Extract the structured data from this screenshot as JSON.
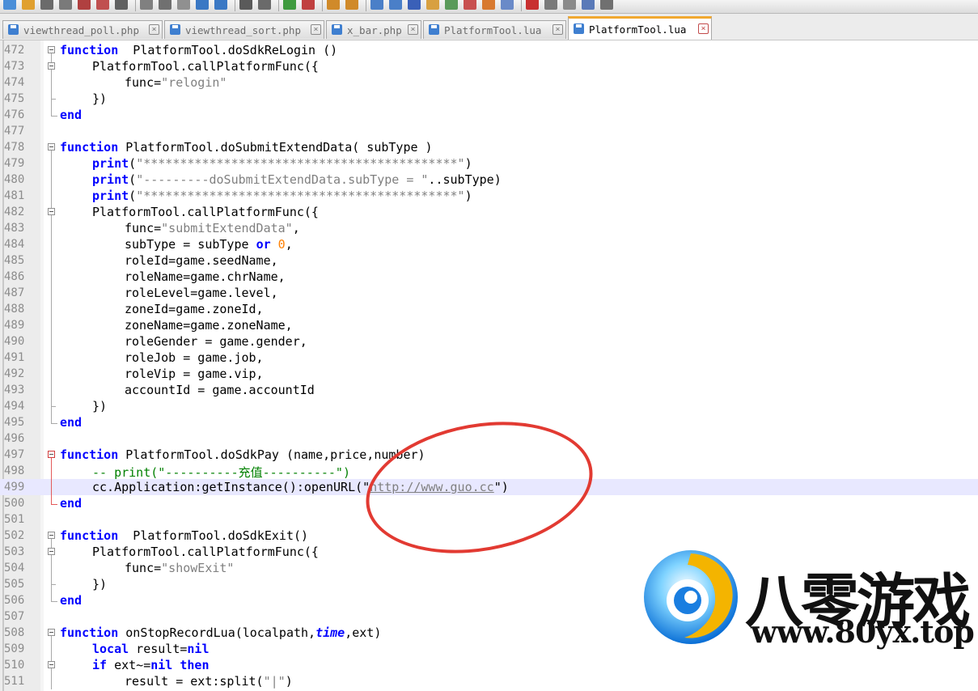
{
  "toolbar": {
    "icons": [
      "new-file-icon",
      "open-file-icon",
      "save-icon",
      "save-all-icon",
      "close-icon",
      "close-all-icon",
      "print-icon",
      "cut-icon",
      "copy-icon",
      "paste-icon",
      "undo-icon",
      "redo-icon",
      "find-icon",
      "replace-icon",
      "zoom-in-icon",
      "zoom-out-icon",
      "sync-vertical-icon",
      "sync-horizontal-icon",
      "word-wrap-icon",
      "show-all-chars-icon",
      "indent-guide-icon",
      "user-language-icon",
      "doc-map-icon",
      "function-list-icon",
      "folder-workspace-icon",
      "monitoring-icon",
      "record-macro-icon",
      "stop-record-icon",
      "play-macro-icon",
      "run-macro-multiple-icon",
      "save-macro-icon"
    ]
  },
  "tabs": [
    {
      "label": "viewthread_poll.php",
      "active": false
    },
    {
      "label": "viewthread_sort.php",
      "active": false
    },
    {
      "label": "x_bar.php",
      "active": false
    },
    {
      "label": "PlatformTool.lua",
      "active": false
    },
    {
      "label": "PlatformTool.lua",
      "active": true
    }
  ],
  "editor": {
    "current_line": "499",
    "lines": [
      {
        "n": "472",
        "segments": [
          [
            "kw",
            "function"
          ],
          [
            "",
            "  PlatformTool.doSdkReLogin ()"
          ]
        ]
      },
      {
        "n": "473",
        "segments": [
          [
            "",
            "PlatformTool.callPlatformFunc({"
          ]
        ]
      },
      {
        "n": "474",
        "segments": [
          [
            "",
            "func="
          ],
          [
            "str",
            "\"relogin\""
          ]
        ]
      },
      {
        "n": "475",
        "segments": [
          [
            "",
            "})"
          ]
        ]
      },
      {
        "n": "476",
        "segments": [
          [
            "kw",
            "end"
          ]
        ]
      },
      {
        "n": "477",
        "segments": []
      },
      {
        "n": "478",
        "segments": [
          [
            "kw",
            "function"
          ],
          [
            "",
            " PlatformTool.doSubmitExtendData( subType )"
          ]
        ]
      },
      {
        "n": "479",
        "segments": [
          [
            "kw",
            "print"
          ],
          [
            "",
            "("
          ],
          [
            "str",
            "\"*******************************************\""
          ],
          [
            "",
            ")"
          ]
        ]
      },
      {
        "n": "480",
        "segments": [
          [
            "kw",
            "print"
          ],
          [
            "",
            "("
          ],
          [
            "str",
            "\"---------doSubmitExtendData.subType = \""
          ],
          [
            "",
            "..subType)"
          ]
        ]
      },
      {
        "n": "481",
        "segments": [
          [
            "kw",
            "print"
          ],
          [
            "",
            "("
          ],
          [
            "str",
            "\"*******************************************\""
          ],
          [
            "",
            ")"
          ]
        ]
      },
      {
        "n": "482",
        "segments": [
          [
            "",
            "PlatformTool.callPlatformFunc({"
          ]
        ]
      },
      {
        "n": "483",
        "segments": [
          [
            "",
            "func="
          ],
          [
            "str",
            "\"submitExtendData\""
          ],
          [
            "",
            ","
          ]
        ]
      },
      {
        "n": "484",
        "segments": [
          [
            "",
            "subType = subType "
          ],
          [
            "kw",
            "or"
          ],
          [
            "",
            " "
          ],
          [
            "num",
            "0"
          ],
          [
            "",
            ","
          ]
        ]
      },
      {
        "n": "485",
        "segments": [
          [
            "",
            "roleId=game.seedName,"
          ]
        ]
      },
      {
        "n": "486",
        "segments": [
          [
            "",
            "roleName=game.chrName,"
          ]
        ]
      },
      {
        "n": "487",
        "segments": [
          [
            "",
            "roleLevel=game.level,"
          ]
        ]
      },
      {
        "n": "488",
        "segments": [
          [
            "",
            "zoneId=game.zoneId,"
          ]
        ]
      },
      {
        "n": "489",
        "segments": [
          [
            "",
            "zoneName=game.zoneName,"
          ]
        ]
      },
      {
        "n": "490",
        "segments": [
          [
            "",
            "roleGender = game.gender,"
          ]
        ]
      },
      {
        "n": "491",
        "segments": [
          [
            "",
            "roleJob = game.job,"
          ]
        ]
      },
      {
        "n": "492",
        "segments": [
          [
            "",
            "roleVip = game.vip,"
          ]
        ]
      },
      {
        "n": "493",
        "segments": [
          [
            "",
            "accountId = game.accountId"
          ]
        ]
      },
      {
        "n": "494",
        "segments": [
          [
            "",
            "})"
          ]
        ]
      },
      {
        "n": "495",
        "segments": [
          [
            "kw",
            "end"
          ]
        ]
      },
      {
        "n": "496",
        "segments": []
      },
      {
        "n": "497",
        "segments": [
          [
            "kw",
            "function"
          ],
          [
            "",
            " PlatformTool.doSdkPay (name,price,number)"
          ]
        ]
      },
      {
        "n": "498",
        "segments": [
          [
            "cm",
            "-- print(\"----------充值----------\")"
          ]
        ]
      },
      {
        "n": "499",
        "segments": [
          [
            "",
            "cc.Application:getInstance():openURL(\""
          ],
          [
            "url",
            "http://www.guo.cc"
          ],
          [
            "",
            "\")"
          ]
        ]
      },
      {
        "n": "500",
        "segments": [
          [
            "kw",
            "end"
          ]
        ]
      },
      {
        "n": "501",
        "segments": []
      },
      {
        "n": "502",
        "segments": [
          [
            "kw",
            "function"
          ],
          [
            "",
            "  PlatformTool.doSdkExit()"
          ]
        ]
      },
      {
        "n": "503",
        "segments": [
          [
            "",
            "PlatformTool.callPlatformFunc({"
          ]
        ]
      },
      {
        "n": "504",
        "segments": [
          [
            "",
            "func="
          ],
          [
            "str",
            "\"showExit\""
          ]
        ]
      },
      {
        "n": "505",
        "segments": [
          [
            "",
            "})"
          ]
        ]
      },
      {
        "n": "506",
        "segments": [
          [
            "kw",
            "end"
          ]
        ]
      },
      {
        "n": "507",
        "segments": []
      },
      {
        "n": "508",
        "segments": [
          [
            "kw",
            "function"
          ],
          [
            "",
            " onStopRecordLua(localpath,"
          ],
          [
            "em",
            "time"
          ],
          [
            "",
            ",ext)"
          ]
        ]
      },
      {
        "n": "509",
        "segments": [
          [
            "kw",
            "local"
          ],
          [
            "",
            " result="
          ],
          [
            "kw",
            "nil"
          ]
        ]
      },
      {
        "n": "510",
        "segments": [
          [
            "kw",
            "if"
          ],
          [
            "",
            " ext~="
          ],
          [
            "kw",
            "nil"
          ],
          [
            "",
            " "
          ],
          [
            "kw",
            "then"
          ]
        ]
      },
      {
        "n": "511",
        "segments": [
          [
            "",
            "result = ext:split("
          ],
          [
            "str",
            "\"|\""
          ],
          [
            "",
            ")"
          ]
        ]
      }
    ]
  },
  "annotation": {
    "shape": "red-ellipse",
    "color": "#e23a32"
  },
  "watermark": {
    "title": "八零游戏",
    "url": "www.80yx.top"
  },
  "colors": {
    "keyword": "#0000ff",
    "string": "#808080",
    "number": "#ff8000",
    "comment": "#008000",
    "active_tab_accent": "#f0a830"
  }
}
